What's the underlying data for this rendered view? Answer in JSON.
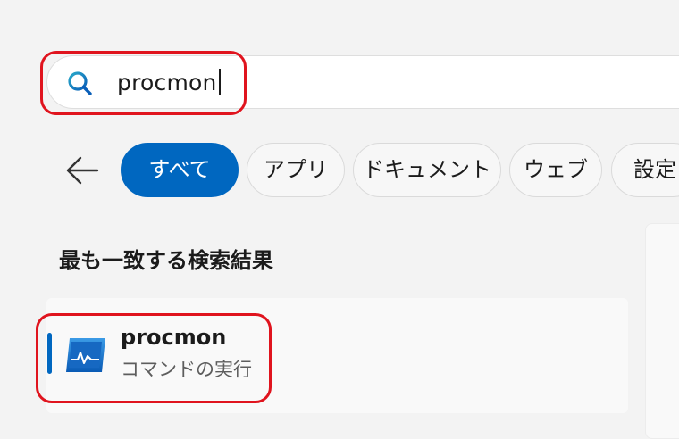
{
  "search": {
    "query": "procmon"
  },
  "filters": [
    {
      "label": "すべて",
      "active": true
    },
    {
      "label": "アプリ",
      "active": false
    },
    {
      "label": "ドキュメント",
      "active": false
    },
    {
      "label": "ウェブ",
      "active": false
    },
    {
      "label": "設定",
      "active": false
    }
  ],
  "best_match": {
    "heading": "最も一致する検索結果",
    "name": "procmon",
    "subtitle": "コマンドの実行"
  },
  "colors": {
    "accent": "#0067c0",
    "highlight": "#e0141e"
  },
  "icons": {
    "search": "search-icon",
    "back": "back-arrow-icon",
    "app": "process-monitor-icon"
  }
}
